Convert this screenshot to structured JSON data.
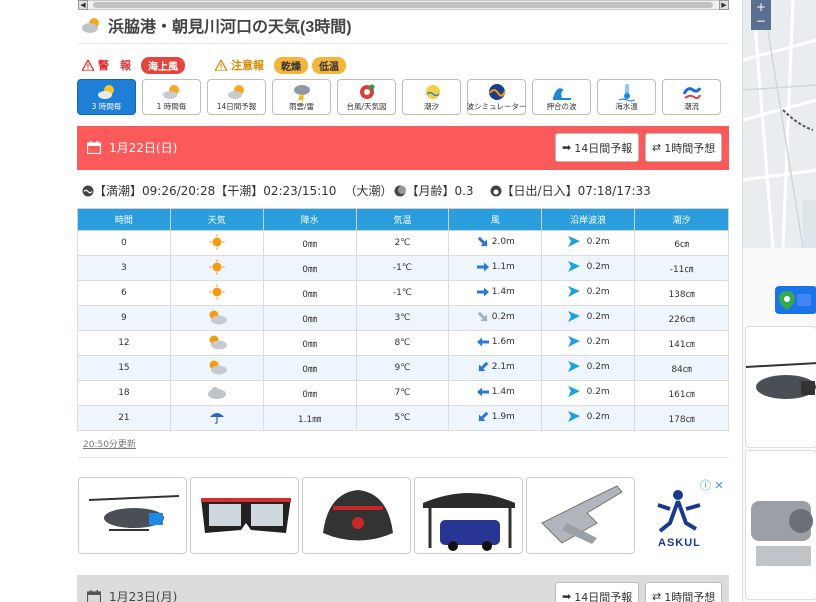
{
  "page": {
    "title": "浜脇港・朝見川河口の天気(3時間)"
  },
  "warnings": {
    "warning_label": "警　報",
    "warning_items": [
      "海上風"
    ],
    "advisory_label": "注意報",
    "advisory_items": [
      "乾燥",
      "低温"
    ]
  },
  "tabs": [
    {
      "label": "3 時間毎",
      "icon": "sun-cloud-icon",
      "active": true
    },
    {
      "label": "1 時間毎",
      "icon": "sun-cloud-icon",
      "active": false
    },
    {
      "label": "14日間予報",
      "icon": "sun-cloud-icon",
      "active": false
    },
    {
      "label": "雨雲/雷",
      "icon": "cloud-lightning-icon",
      "active": false
    },
    {
      "label": "台風/天気図",
      "icon": "typhoon-icon",
      "active": false
    },
    {
      "label": "潮汐",
      "icon": "tide-icon",
      "active": false
    },
    {
      "label": "波シミュレーター",
      "icon": "wave-sim-icon",
      "active": false
    },
    {
      "label": "押合の波",
      "icon": "wave-icon",
      "active": false
    },
    {
      "label": "海水温",
      "icon": "thermometer-icon",
      "active": false
    },
    {
      "label": "潮流",
      "icon": "current-icon",
      "active": false
    }
  ],
  "day1": {
    "date": "1月22日(日)",
    "btn_14day": "14日間予報",
    "btn_1hour": "1時間予想",
    "tide_info": {
      "high": "【満潮】09:26/20:28",
      "low": "【干潮】02:23/15:10",
      "tide_type": "（大潮）",
      "moon": "【月齢】0.3",
      "sun": "【日出/日入】07:18/17:33"
    },
    "columns": [
      "時間",
      "天気",
      "降水",
      "気温",
      "風",
      "沿岸波浪",
      "潮汐"
    ],
    "rows": [
      {
        "time": "0",
        "weather": "sunny",
        "precip": "0㎜",
        "temp": "2℃",
        "wind": "2.0m",
        "wind_dir": "se",
        "wave": "0.2m",
        "tide": "6㎝"
      },
      {
        "time": "3",
        "weather": "sunny",
        "precip": "0㎜",
        "temp": "-1℃",
        "wind": "1.1m",
        "wind_dir": "e",
        "wave": "0.2m",
        "tide": "-11㎝"
      },
      {
        "time": "6",
        "weather": "sunny",
        "precip": "0㎜",
        "temp": "-1℃",
        "wind": "1.4m",
        "wind_dir": "e",
        "wave": "0.2m",
        "tide": "138㎝"
      },
      {
        "time": "9",
        "weather": "partly-cloudy",
        "precip": "0㎜",
        "temp": "3℃",
        "wind": "0.2m",
        "wind_dir": "se-light",
        "wave": "0.2m",
        "tide": "226㎝"
      },
      {
        "time": "12",
        "weather": "partly-cloudy",
        "precip": "0㎜",
        "temp": "8℃",
        "wind": "1.6m",
        "wind_dir": "w",
        "wave": "0.2m",
        "tide": "141㎝"
      },
      {
        "time": "15",
        "weather": "partly-cloudy",
        "precip": "0㎜",
        "temp": "9℃",
        "wind": "2.1m",
        "wind_dir": "sw",
        "wave": "0.2m",
        "tide": "84㎝"
      },
      {
        "time": "18",
        "weather": "cloudy",
        "precip": "0㎜",
        "temp": "7℃",
        "wind": "1.4m",
        "wind_dir": "w",
        "wave": "0.2m",
        "tide": "161㎝"
      },
      {
        "time": "21",
        "weather": "rain",
        "precip": "1.1㎜",
        "temp": "5℃",
        "wind": "1.9m",
        "wind_dir": "sw",
        "wave": "0.2m",
        "tide": "178㎝"
      }
    ],
    "updated": "20:50分更新"
  },
  "ads": {
    "advertiser": "ASKUL",
    "info_icon": "ⓘ ✕"
  },
  "day2": {
    "date": "1月23日(月)",
    "btn_14day": "14日間予報",
    "btn_1hour": "1時間予想"
  },
  "colors": {
    "header_red": "#fb5a5a",
    "table_header_blue": "#2a9ddd",
    "tab_active": "#1f7fd6",
    "warning_red": "#e8443e",
    "advisory_yellow": "#f4b53b"
  }
}
